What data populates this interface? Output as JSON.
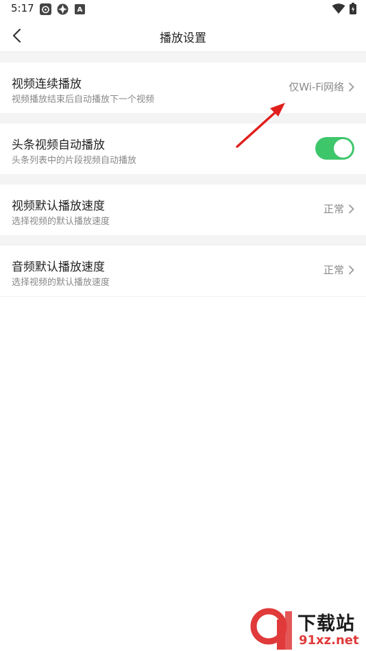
{
  "status": {
    "time": "5:17",
    "left_icons": [
      "weibo-icon",
      "aperture-icon",
      "a-letter-icon"
    ],
    "a_letter": "A",
    "right_icons": [
      "wifi-icon",
      "battery-icon"
    ]
  },
  "nav": {
    "title": "播放设置",
    "back_icon": "chevron-left-icon"
  },
  "settings": [
    {
      "title": "视频连续播放",
      "subtitle": "视频播放结束后自动播放下一个视频",
      "value": "仅Wi-Fi网络",
      "control": "chevron"
    },
    {
      "title": "头条视频自动播放",
      "subtitle": "头条列表中的片段视频自动播放",
      "control": "toggle",
      "toggle_on": true
    },
    {
      "title": "视频默认播放速度",
      "subtitle": "选择视频的默认播放速度",
      "value": "正常",
      "control": "chevron"
    },
    {
      "title": "音频默认播放速度",
      "subtitle": "选择视频的默认播放速度",
      "value": "正常",
      "control": "chevron"
    }
  ],
  "watermark": {
    "text": "下载站",
    "url": "91xz.net"
  },
  "colors": {
    "accent_green": "#3ec66b",
    "annotation_red": "#e0201c",
    "separator": "#f4f4f4"
  }
}
